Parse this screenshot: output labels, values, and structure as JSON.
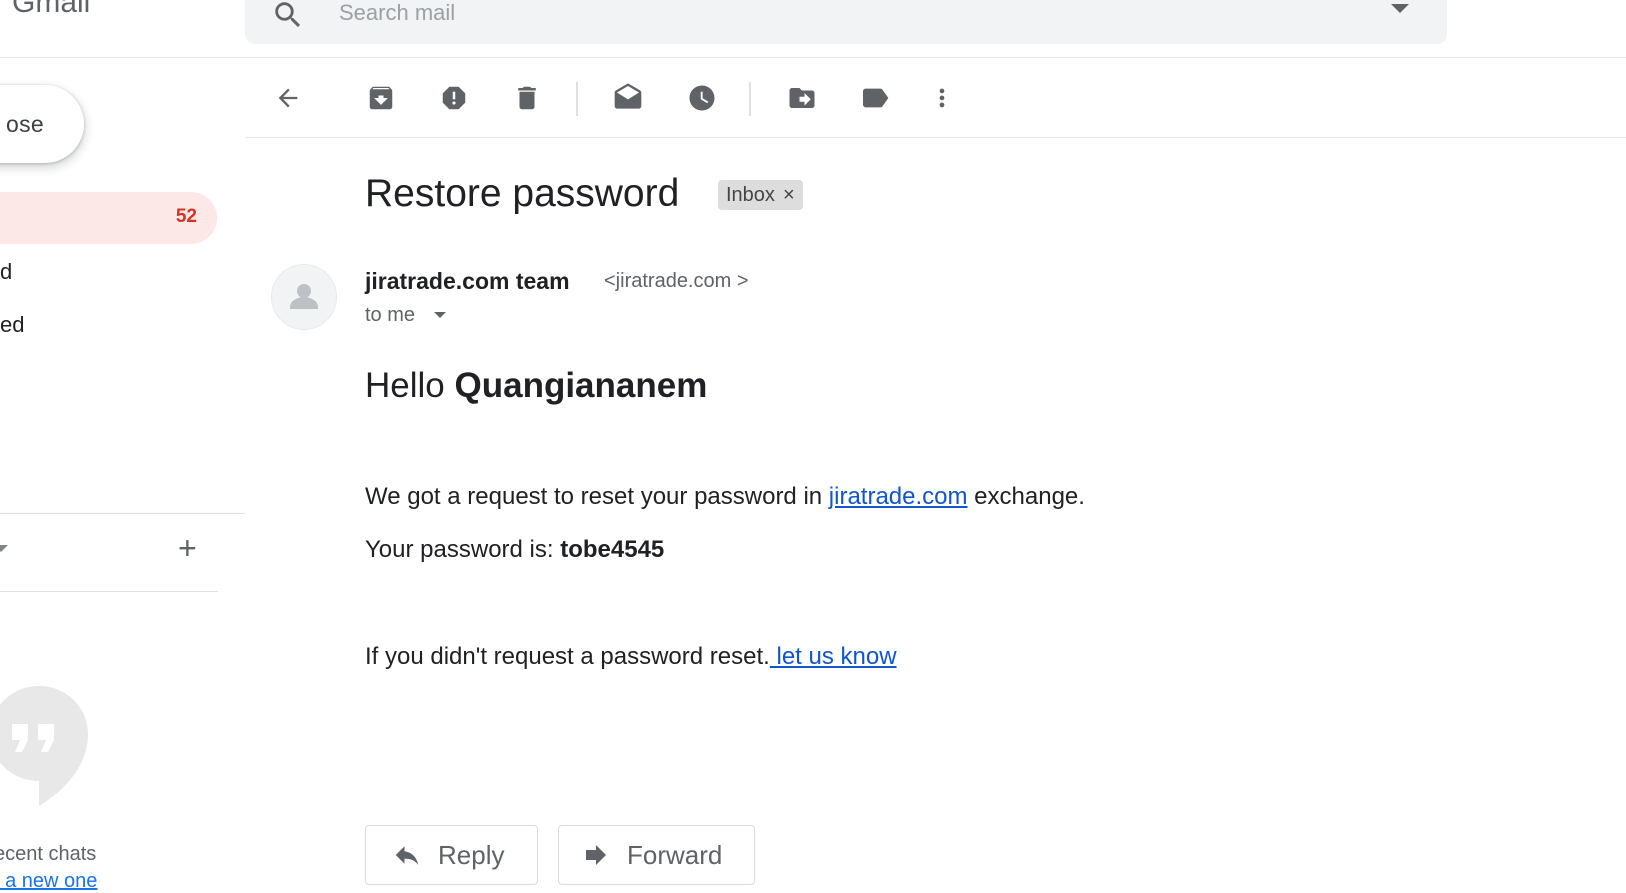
{
  "app": {
    "brand": "Gmail"
  },
  "search": {
    "placeholder": "Search mail"
  },
  "sidebar": {
    "compose_label": "ose",
    "inbox_count": "52",
    "items": [
      "d",
      "ed"
    ],
    "recent_chats": "ecent chats",
    "new_one": "t a new one"
  },
  "toolbar": {
    "icons": [
      "back-arrow-icon",
      "archive-icon",
      "report-spam-icon",
      "delete-icon",
      "mark-unread-icon",
      "snooze-icon",
      "move-to-icon",
      "labels-icon",
      "more-vert-icon"
    ]
  },
  "message": {
    "subject": "Restore password",
    "label_chip": "Inbox",
    "chip_close": "×",
    "sender_name": "jiratrade.com team",
    "sender_email": "<jiratrade.com >",
    "to": "to me",
    "greeting": "Hello",
    "greeting_name": "Quangiananem",
    "line1_pre": "We got a request to reset your password in ",
    "line1_link": "jiratrade.com",
    "line1_post": " exchange.",
    "line2_pre": "Your password is: ",
    "line2_value": "tobe4545",
    "line3_pre": "If you didn't request a password reset.",
    "line3_link": " let us know"
  },
  "actions": {
    "reply": "Reply",
    "forward": "Forward"
  },
  "colors": {
    "inbox_highlight": "#fce8e6",
    "count_red": "#d93025",
    "link": "#1155cc"
  }
}
